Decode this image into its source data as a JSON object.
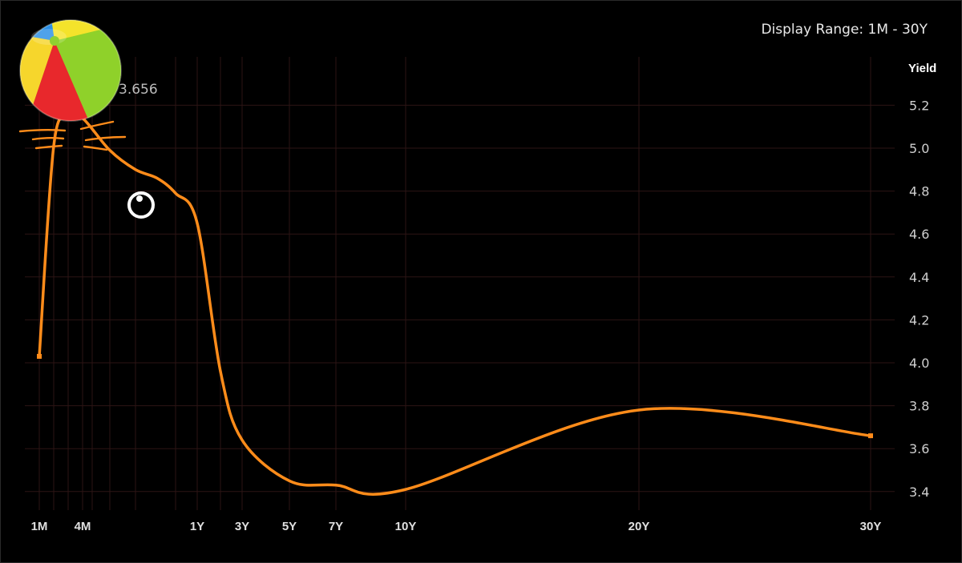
{
  "header": {
    "display_range": "Display Range: 1M - 30Y"
  },
  "chart_data": {
    "type": "line",
    "ylabel": "Yield",
    "ylim": [
      3.3,
      5.4
    ],
    "y_ticks": [
      "3.4",
      "3.6",
      "3.8",
      "4.0",
      "4.2",
      "4.4",
      "4.6",
      "4.8",
      "5.0",
      "5.2"
    ],
    "x_ticks": [
      "1M",
      "4M",
      "1Y",
      "3Y",
      "5Y",
      "7Y",
      "10Y",
      "20Y",
      "30Y"
    ],
    "hover_value": "3.656",
    "series": [
      {
        "color": "#ff8c1a",
        "points": [
          {
            "x": "1M",
            "y": 4.03
          },
          {
            "x": "2M",
            "y": 5.01
          },
          {
            "x": "3M",
            "y": 5.15
          },
          {
            "x": "4M",
            "y": 5.14
          },
          {
            "x": "6M",
            "y": 4.99
          },
          {
            "x": "7M",
            "y": 4.9
          },
          {
            "x": "8M",
            "y": 4.86
          },
          {
            "x": "9M",
            "y": 4.79
          },
          {
            "x": "1Y",
            "y": 4.65
          },
          {
            "x": "2Y",
            "y": 3.96
          },
          {
            "x": "3Y",
            "y": 3.64
          },
          {
            "x": "5Y",
            "y": 3.45
          },
          {
            "x": "7Y",
            "y": 3.43
          },
          {
            "x": "10Y",
            "y": 3.41
          },
          {
            "x": "20Y",
            "y": 3.78
          },
          {
            "x": "30Y",
            "y": 3.66
          }
        ]
      }
    ]
  },
  "overlay": {
    "icons": [
      "beach-ball-icon",
      "eye-icon",
      "whiskers-icon"
    ]
  }
}
